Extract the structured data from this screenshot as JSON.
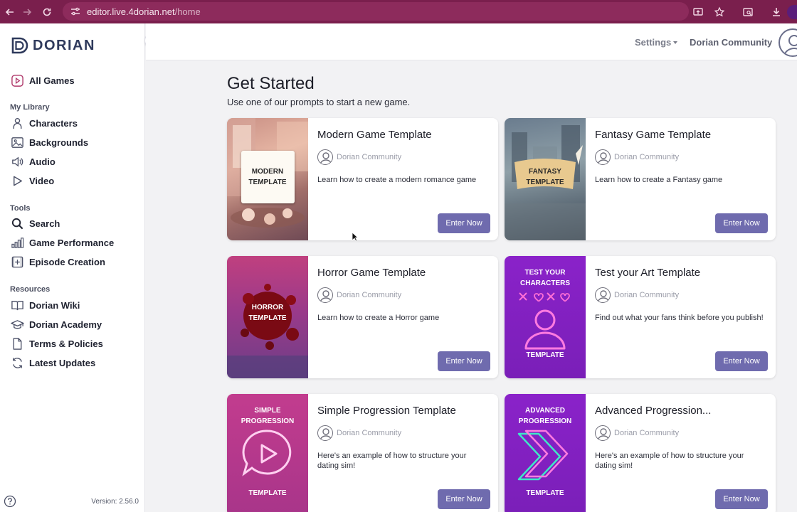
{
  "browser": {
    "url_host": "editor.live.4dorian.net",
    "url_path": "/home"
  },
  "sidebar": {
    "brand": "DORIAN",
    "all_games": "All Games",
    "sections": {
      "library": "My Library",
      "tools": "Tools",
      "resources": "Resources"
    },
    "library_items": [
      {
        "label": "Characters",
        "icon": "person-icon"
      },
      {
        "label": "Backgrounds",
        "icon": "image-icon"
      },
      {
        "label": "Audio",
        "icon": "speaker-icon"
      },
      {
        "label": "Video",
        "icon": "play-icon"
      }
    ],
    "tool_items": [
      {
        "label": "Search",
        "icon": "search-icon"
      },
      {
        "label": "Game Performance",
        "icon": "bar-chart-icon"
      },
      {
        "label": "Episode Creation",
        "icon": "add-episode-icon"
      }
    ],
    "resource_items": [
      {
        "label": "Dorian Wiki",
        "icon": "book-icon"
      },
      {
        "label": "Dorian Academy",
        "icon": "graduation-cap-icon"
      },
      {
        "label": "Terms & Policies",
        "icon": "document-icon"
      },
      {
        "label": "Latest Updates",
        "icon": "refresh-icon"
      }
    ],
    "version": "Version: 2.56.0"
  },
  "header": {
    "settings": "Settings",
    "community": "Dorian Community"
  },
  "main": {
    "title": "Get Started",
    "subtitle": "Use one of our prompts to start a new game.",
    "cards": [
      {
        "title": "Modern Game Template",
        "author": "Dorian Community",
        "description": "Learn how to create a modern romance game",
        "button": "Enter Now",
        "thumb_text": [
          "MODERN",
          "TEMPLATE"
        ]
      },
      {
        "title": "Fantasy Game Template",
        "author": "Dorian Community",
        "description": "Learn how to create a Fantasy game",
        "button": "Enter Now",
        "thumb_text": [
          "FANTASY",
          "TEMPLATE"
        ]
      },
      {
        "title": "Horror Game Template",
        "author": "Dorian Community",
        "description": "Learn how to create a Horror game",
        "button": "Enter Now",
        "thumb_text": [
          "HORROR",
          "TEMPLATE"
        ]
      },
      {
        "title": "Test your Art Template",
        "author": "Dorian Community",
        "description": "Find out what your fans think before you publish!",
        "button": "Enter Now",
        "thumb_text": [
          "TEST YOUR",
          "CHARACTERS",
          "TEMPLATE"
        ]
      },
      {
        "title": "Simple Progression Template",
        "author": "Dorian Community",
        "description": "Here's an example of how to structure your dating sim!",
        "button": "Enter Now",
        "thumb_text": [
          "SIMPLE",
          "PROGRESSION",
          "TEMPLATE"
        ]
      },
      {
        "title": "Advanced Progression...",
        "author": "Dorian Community",
        "description": "Here's an example of how to structure your dating sim!",
        "button": "Enter Now",
        "thumb_text": [
          "ADVANCED",
          "PROGRESSION",
          "TEMPLATE"
        ]
      }
    ]
  },
  "colors": {
    "chrome": "#7a1f4d",
    "button": "#6f6bae",
    "brand": "#2f3a5c",
    "purple_thumb": "#8a22c9",
    "pink_thumb": "#b83a8c"
  }
}
